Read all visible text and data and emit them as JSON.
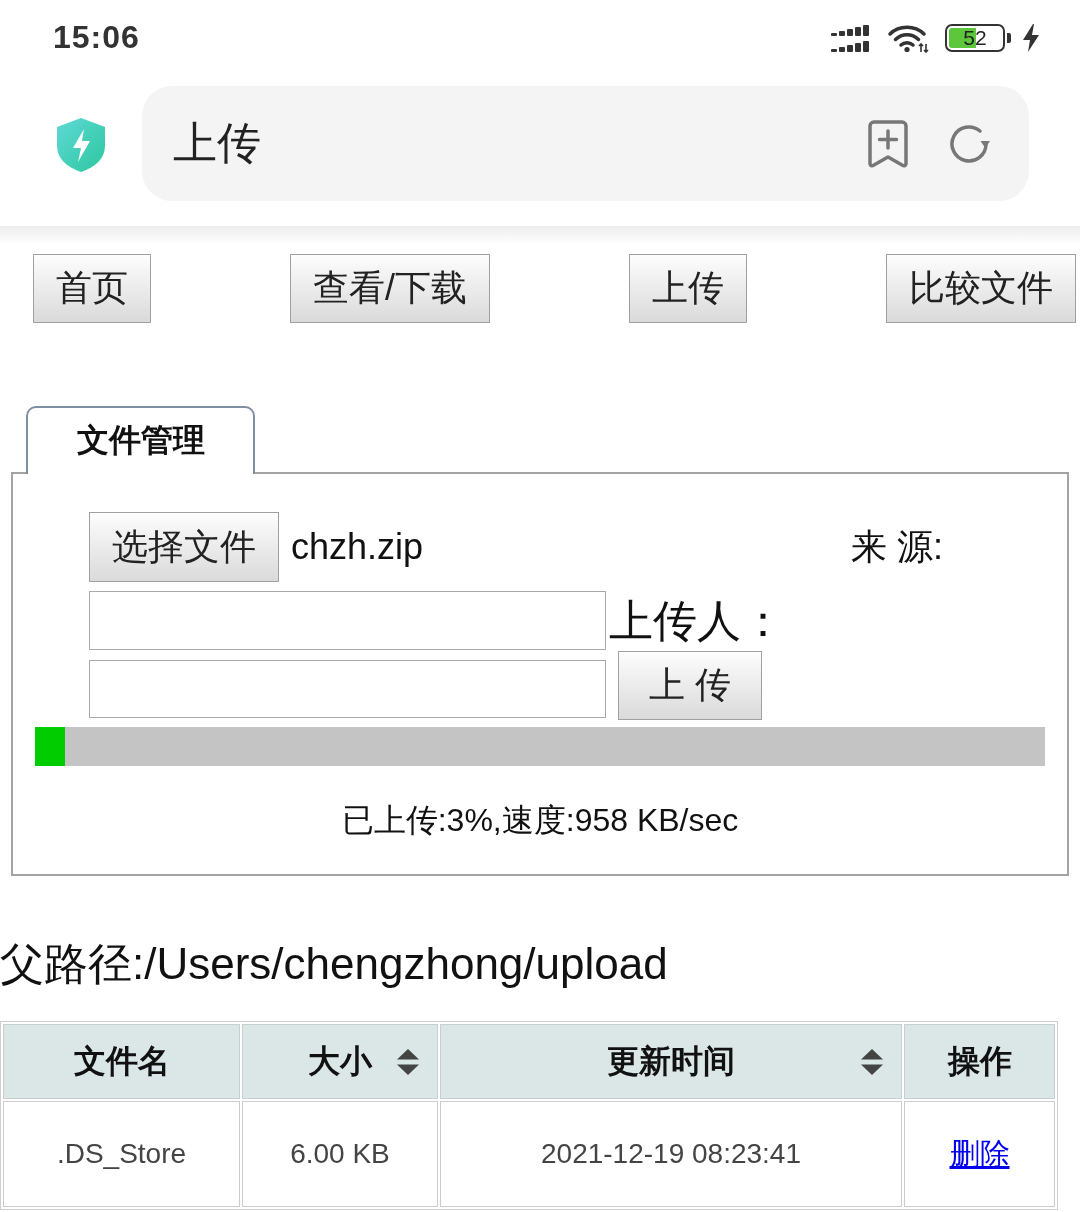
{
  "status_bar": {
    "time": "15:06",
    "battery": "52"
  },
  "address_bar": {
    "title": "上传"
  },
  "nav": [
    "首页",
    "查看/下载",
    "上传",
    "比较文件"
  ],
  "panel": {
    "tab": {
      "label": "文件管理",
      "selected": true
    },
    "file_button": "选择文件",
    "file_name": "chzh.zip",
    "source_label": "来 源:",
    "uploader_label": "上传人：",
    "fields": [
      {
        "kind": "text"
      },
      {
        "kind": "text"
      }
    ],
    "upload_button": "上 传",
    "progress": {
      "level": 0.03
    },
    "progress_text": "已上传:3%,速度:958 KB/sec"
  },
  "path": "父路径:/Users/chengzhong/upload",
  "table": {
    "columns": [
      {
        "label": "文件名",
        "sortable": false
      },
      {
        "label": "大小",
        "sortable": true
      },
      {
        "label": "更新时间",
        "sortable": true
      },
      {
        "label": "操作",
        "sortable": false
      }
    ],
    "rows": [
      {
        "cells": [
          ".DS_Store",
          "6.00 KB",
          "2021-12-19 08:23:41"
        ],
        "action": "删除"
      }
    ]
  }
}
